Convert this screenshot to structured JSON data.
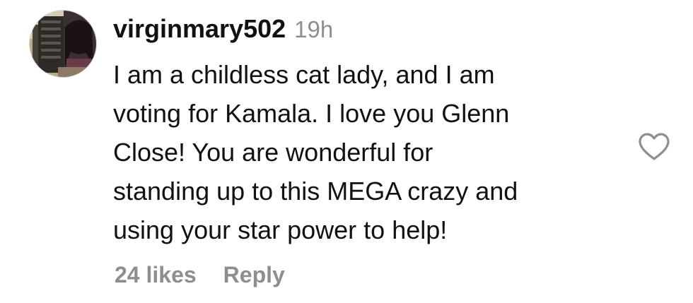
{
  "comment": {
    "username": "virginmary502",
    "timestamp": "19h",
    "text_lines": [
      "I am a childless cat lady, and I am",
      "voting for Kamala. I love you Glenn",
      "Close! You are wonderful for",
      "standing up to this MEGA crazy and",
      "using your star power to help!"
    ],
    "likes_label": "24 likes",
    "reply_label": "Reply",
    "like_icon": "heart-outline-icon",
    "avatar_icon": "user-avatar-photo"
  }
}
